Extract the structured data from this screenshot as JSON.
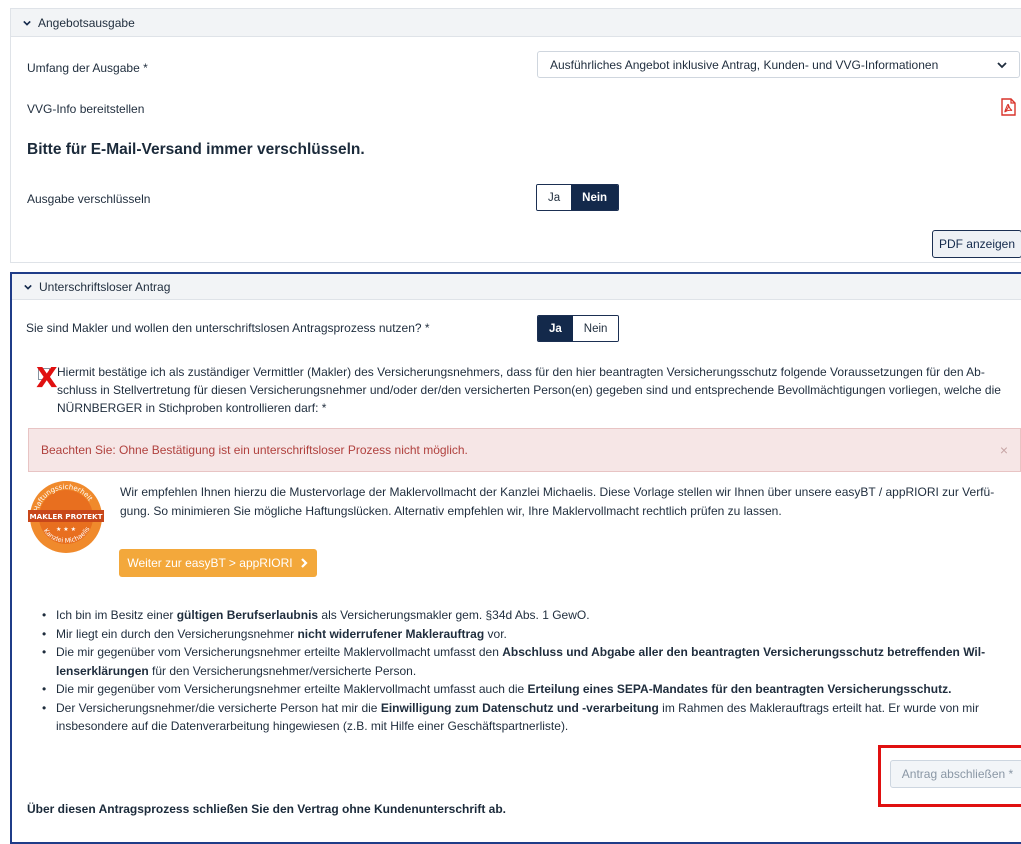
{
  "section1": {
    "header": "Angebotsausgabe",
    "scope_label": "Umfang der Ausgabe *",
    "scope_value": "Ausführliches Angebot inklusive Antrag, Kunden- und VVG-Informationen",
    "vvg_label": "VVG-Info bereitstellen",
    "heading": "Bitte für E-Mail-Versand immer verschlüsseln.",
    "encrypt_label": "Ausgabe verschlüsseln",
    "yes": "Ja",
    "no": "Nein",
    "encrypt_selected": "Nein",
    "pdf_button": "PDF anzeigen"
  },
  "section2": {
    "header": "Unterschriftsloser Antrag",
    "question": "Sie sind Makler und wollen den unterschriftslosen Antragsprozess nutzen? *",
    "yes": "Ja",
    "no": "Nein",
    "selected": "Ja",
    "confirm_text": "Hiermit bestätige ich als zuständiger Vermittler (Makler) des Versicherungsnehmers, dass für den hier beantragten Versicherungsschutz folgende Voraussetzungen für den Ab­schluss in Stellvertretung für diesen Versicherungsnehmer und/oder der/den versicherten Person(en) gegeben sind und entsprechende Bevollmächtigungen vorliegen, welche die NÜRNBERGER in Stichproben kontrollieren darf: *",
    "alert": "Beachten Sie: Ohne Bestätigung ist ein unterschriftsloser Prozess nicht möglich.",
    "alert_close": "×",
    "badge_top": "Haftungssicherheit",
    "badge_mid": "MAKLER PROTEKT",
    "badge_bottom": "Kanzlei Michaelis",
    "promo": "Wir empfehlen Ihnen hierzu die Mustervorlage der Maklervollmacht der Kanzlei Michaelis. Diese Vorlage stellen wir Ihnen über unsere easyBT / appRIORI zur Verfü­gung. So minimieren Sie mögliche Haftungslücken. Alternativ empfehlen wir, Ihre Maklervollmacht rechtlich prüfen zu lassen.",
    "promo_button": "Weiter zur easyBT > appRIORI",
    "bullets": [
      {
        "pre": "Ich bin im Besitz einer ",
        "bold": "gültigen Berufserlaubnis",
        "post": " als Versicherungsmakler gem. §34d Abs. 1 GewO."
      },
      {
        "pre": "Mir liegt ein durch den Versicherungsnehmer ",
        "bold": "nicht widerrufener Maklerauftrag",
        "post": " vor."
      },
      {
        "pre": "Die mir gegenüber vom Versicherungsnehmer erteilte Maklervollmacht umfasst den ",
        "bold": "Abschluss und Abgabe aller den beantragten Versicherungsschutz betreffenden Wil­lenserklärungen",
        "post": " für den Versicherungsnehmer/versicherte Person."
      },
      {
        "pre": "Die mir gegenüber vom Versicherungsnehmer erteilte Maklervollmacht umfasst auch die ",
        "bold": "Erteilung eines SEPA-Mandates für den beantragten Versicherungsschutz.",
        "post": ""
      },
      {
        "pre": "Der Versicherungsnehmer/die versicherte Person hat mir die ",
        "bold": "Einwilligung zum Datenschutz und -verarbeitung",
        "post": " im Rahmen des Maklerauftrags erteilt hat. Er wurde von mir insbesondere auf die Datenverarbeitung hingewiesen (z.B. mit Hilfe einer Geschäftspartnerliste)."
      }
    ],
    "submit": "Antrag abschließen *",
    "footer_note": "Über diesen Antragsprozess schließen Sie den Vertrag ohne Kundenunterschrift ab.",
    "annotation_mark": "X"
  },
  "colors": {
    "navy": "#13294b",
    "alert_bg": "#f6e6e6",
    "alert_text": "#b0413e",
    "orange": "#f3a83b",
    "annotation_red": "#e01010",
    "pdf_red": "#d9342b"
  }
}
